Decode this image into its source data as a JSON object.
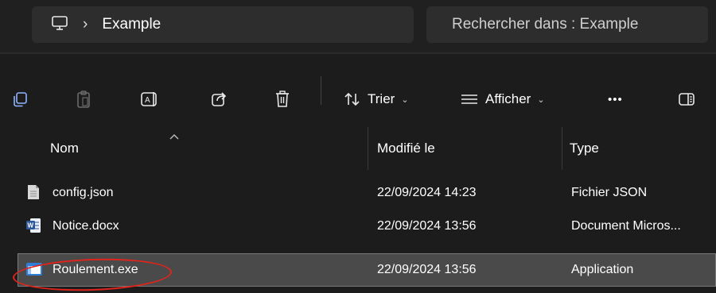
{
  "address": {
    "icon": "computer-icon",
    "separator": "›",
    "folder": "Example"
  },
  "search": {
    "placeholder": "Rechercher dans : Example"
  },
  "toolbar": {
    "icons": [
      "copy-icon",
      "paste-icon",
      "rename-icon",
      "share-icon",
      "delete-icon"
    ],
    "sort_label": "Trier",
    "view_label": "Afficher",
    "more_label": "•••",
    "details_icon": "details-pane-icon"
  },
  "columns": {
    "name": "Nom",
    "modified": "Modifié le",
    "type": "Type"
  },
  "files": [
    {
      "name": "config.json",
      "modified": "22/09/2024 14:23",
      "type": "Fichier JSON",
      "icon": "text-file-icon"
    },
    {
      "name": "Notice.docx",
      "modified": "22/09/2024 13:56",
      "type": "Document Micros...",
      "icon": "word-document-icon"
    },
    {
      "name": "Roulement.exe",
      "modified": "22/09/2024 13:56",
      "type": "Application",
      "icon": "application-icon",
      "selected": true
    }
  ],
  "colors": {
    "background": "#1c1c1c",
    "selection": "#4a4a4a",
    "annotation": "#e0241b",
    "word_blue": "#2b579a"
  }
}
